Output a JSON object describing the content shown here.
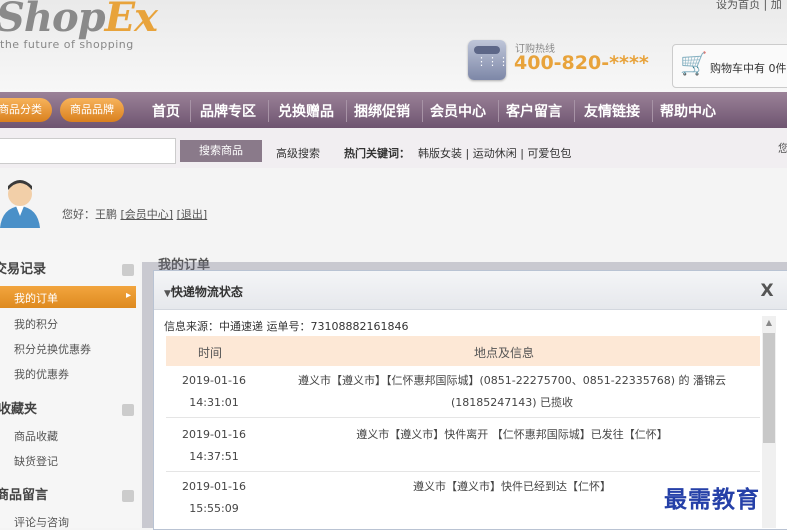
{
  "header": {
    "logo_main": "Shop",
    "logo_accent": "Ex",
    "slogan": "the future of shopping",
    "top_links": "设为首页 | 加",
    "hotline_label": "订购热线",
    "hotline_number": "400-820-****",
    "cart_text": "购物车中有 0件"
  },
  "nav": {
    "pill_category": "商品分类",
    "pill_brand": "商品品牌",
    "items": [
      "首页",
      "品牌专区",
      "兑换赠品",
      "捆绑促销",
      "会员中心",
      "客户留言",
      "友情链接",
      "帮助中心"
    ]
  },
  "search": {
    "button": "搜索商品",
    "advanced": "高级搜索",
    "hot_label": "热门关键词：",
    "hot_words": "韩版女装 | 运动休闲 | 可爱包包",
    "right_cut": "您"
  },
  "user": {
    "greeting_prefix": "您好：王鹏",
    "member_center": "[会员中心]",
    "logout": "[退出]"
  },
  "sidebar": {
    "sections": [
      {
        "title": "交易记录",
        "items": [
          "我的订单",
          "我的积分",
          "积分兑换优惠券",
          "我的优惠券"
        ]
      },
      {
        "title": "收藏夹",
        "items": [
          "商品收藏",
          "缺货登记"
        ]
      },
      {
        "title": "商品留言",
        "items": [
          "评论与咨询"
        ]
      }
    ]
  },
  "page": {
    "title": "我的订单"
  },
  "modal": {
    "title": "快递物流状态",
    "close": "X",
    "info_source": "信息来源：中通速递 运单号：73108882161846",
    "columns": [
      "时间",
      "地点及信息"
    ],
    "rows": [
      {
        "date": "2019-01-16",
        "time": "14:31:01",
        "info": "遵义市【遵义市】【仁怀惠邦国际城】(0851-22275700、0851-22335768) 的 潘锦云 (18185247143) 已揽收"
      },
      {
        "date": "2019-01-16",
        "time": "14:37:51",
        "info": "遵义市【遵义市】快件离开 【仁怀惠邦国际城】已发往【仁怀】"
      },
      {
        "date": "2019-01-16",
        "time": "15:55:09",
        "info": "遵义市【遵义市】快件已经到达【仁怀】"
      }
    ]
  },
  "watermark": "最需教育",
  "colors": {
    "nav_purple": "#7d627d",
    "orange_accent": "#e8a33b",
    "table_header": "#fde8d6"
  }
}
